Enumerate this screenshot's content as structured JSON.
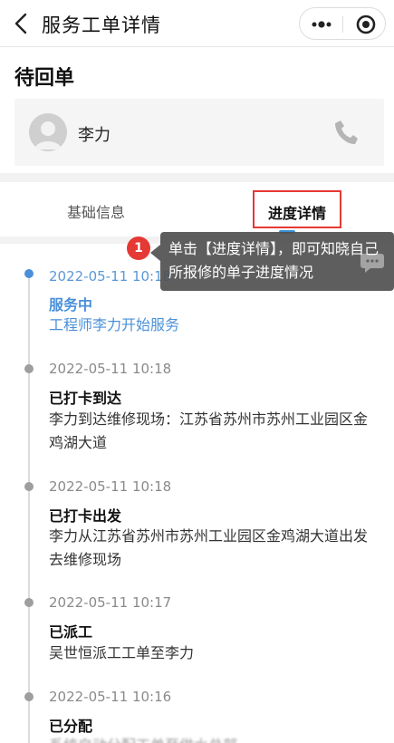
{
  "header": {
    "title": "服务工单详情",
    "back_icon": "chevron-left-icon",
    "more_icon": "more-dots-icon",
    "target_icon": "target-icon"
  },
  "status": {
    "title": "待回单"
  },
  "contact": {
    "name": "李力",
    "avatar_icon": "avatar-icon",
    "phone_icon": "phone-icon"
  },
  "tabs": {
    "basic_label": "基础信息",
    "progress_label": "进度详情",
    "highlight_color": "#e53935",
    "indicator_color": "#3a8fd8"
  },
  "tooltip": {
    "step_number": "1",
    "text": "单击【进度详情】，即可知晓自己所报修的单子进度情况",
    "chat_icon": "chat-bubble-icon"
  },
  "timeline": [
    {
      "time": "2022-05-11 10:18",
      "status": "服务中",
      "desc": "工程师李力开始服务",
      "active": true
    },
    {
      "time": "2022-05-11 10:18",
      "status": "已打卡到达",
      "desc": "李力到达维修现场：江苏省苏州市苏州工业园区金鸡湖大道",
      "active": false
    },
    {
      "time": "2022-05-11 10:18",
      "status": "已打卡出发",
      "desc": "李力从江苏省苏州市苏州工业园区金鸡湖大道出发去维修现场",
      "active": false
    },
    {
      "time": "2022-05-11 10:17",
      "status": "已派工",
      "desc": "吴世恒派工工单至李力",
      "active": false
    },
    {
      "time": "2022-05-11 10:16",
      "status": "已分配",
      "desc": "系统自动分配工单至供水总部",
      "active": false
    }
  ],
  "colors": {
    "active_blue": "#4a90d9",
    "inactive_gray": "#9e9e9e"
  }
}
